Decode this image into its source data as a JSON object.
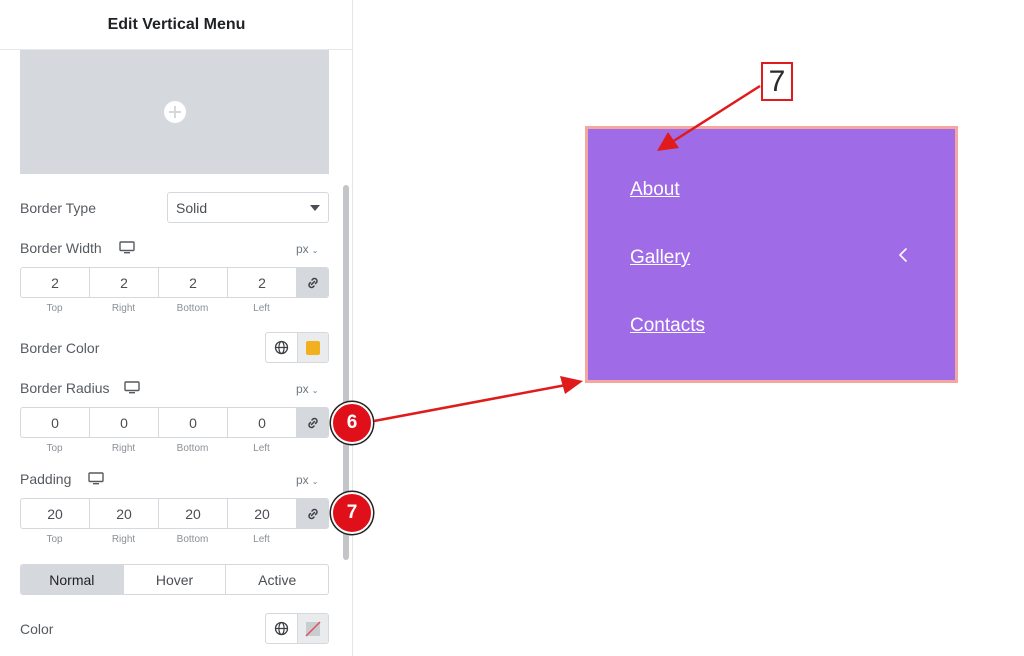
{
  "panel": {
    "title": "Edit Vertical Menu",
    "border_type": {
      "label": "Border Type",
      "value": "Solid"
    },
    "border_width": {
      "label": "Border Width",
      "unit": "px",
      "values": [
        "2",
        "2",
        "2",
        "2"
      ]
    },
    "dim_labels": [
      "Top",
      "Right",
      "Bottom",
      "Left"
    ],
    "border_color": {
      "label": "Border Color",
      "swatch": "#f2b01e"
    },
    "border_radius": {
      "label": "Border Radius",
      "unit": "px",
      "values": [
        "0",
        "0",
        "0",
        "0"
      ]
    },
    "padding": {
      "label": "Padding",
      "unit": "px",
      "values": [
        "20",
        "20",
        "20",
        "20"
      ]
    },
    "state_tabs": [
      "Normal",
      "Hover",
      "Active"
    ],
    "active_tab": "Normal",
    "color": {
      "label": "Color"
    }
  },
  "annotations": {
    "badge_6": "6",
    "badge_7": "7",
    "callout_7": "7",
    "arrow_color": "#e01b1b"
  },
  "preview": {
    "menu_items": [
      "About",
      "Gallery",
      "Contacts"
    ],
    "background": "#9f6be6",
    "border_color": "#f4a7a0"
  },
  "icons": {
    "add": "plus-circle-icon",
    "dropdown": "caret-down-icon",
    "responsive": "desktop-icon",
    "link": "link-icon",
    "global": "globe-icon",
    "submenu": "chevron-left-icon"
  }
}
